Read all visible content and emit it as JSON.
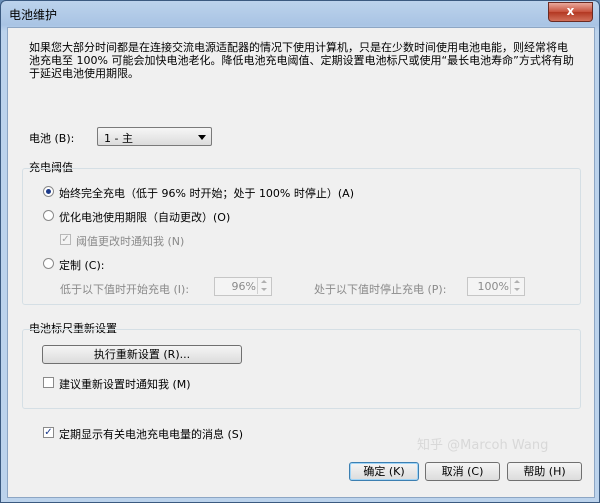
{
  "window": {
    "title": "电池维护",
    "close_label": "x"
  },
  "intro": "如果您大部分时间都是在连接交流电源适配器的情况下使用计算机，只是在少数时间使用电池电能，则经常将电池充电至 100% 可能会加快电池老化。降低电池充电阈值、定期设置电池标尺或使用“最长电池寿命”方式将有助于延迟电池使用期限。",
  "battery": {
    "label": "电池 (B):",
    "selected": "1 - 主"
  },
  "threshold": {
    "title": "充电阈值",
    "option_full": "始终完全充电（低于 96% 时开始；处于 100% 时停止）(A)",
    "option_optimize": "优化电池使用期限（自动更改）(O)",
    "notify_label": "阈值更改时通知我 (N)",
    "option_custom": "定制 (C):",
    "start_label": "低于以下值时开始充电 (I):",
    "start_value": "96%",
    "stop_label": "处于以下值时停止充电 (P):",
    "stop_value": "100%"
  },
  "gauge": {
    "title": "电池标尺重新设置",
    "run_button": "执行重新设置 (R)...",
    "suggest_label": "建议重新设置时通知我 (M)"
  },
  "periodic_label": "定期显示有关电池充电电量的消息 (S)",
  "buttons": {
    "ok": "确定 (K)",
    "cancel": "取消 (C)",
    "help": "帮助 (H)"
  },
  "watermark": "知乎 @Marcoh Wang"
}
